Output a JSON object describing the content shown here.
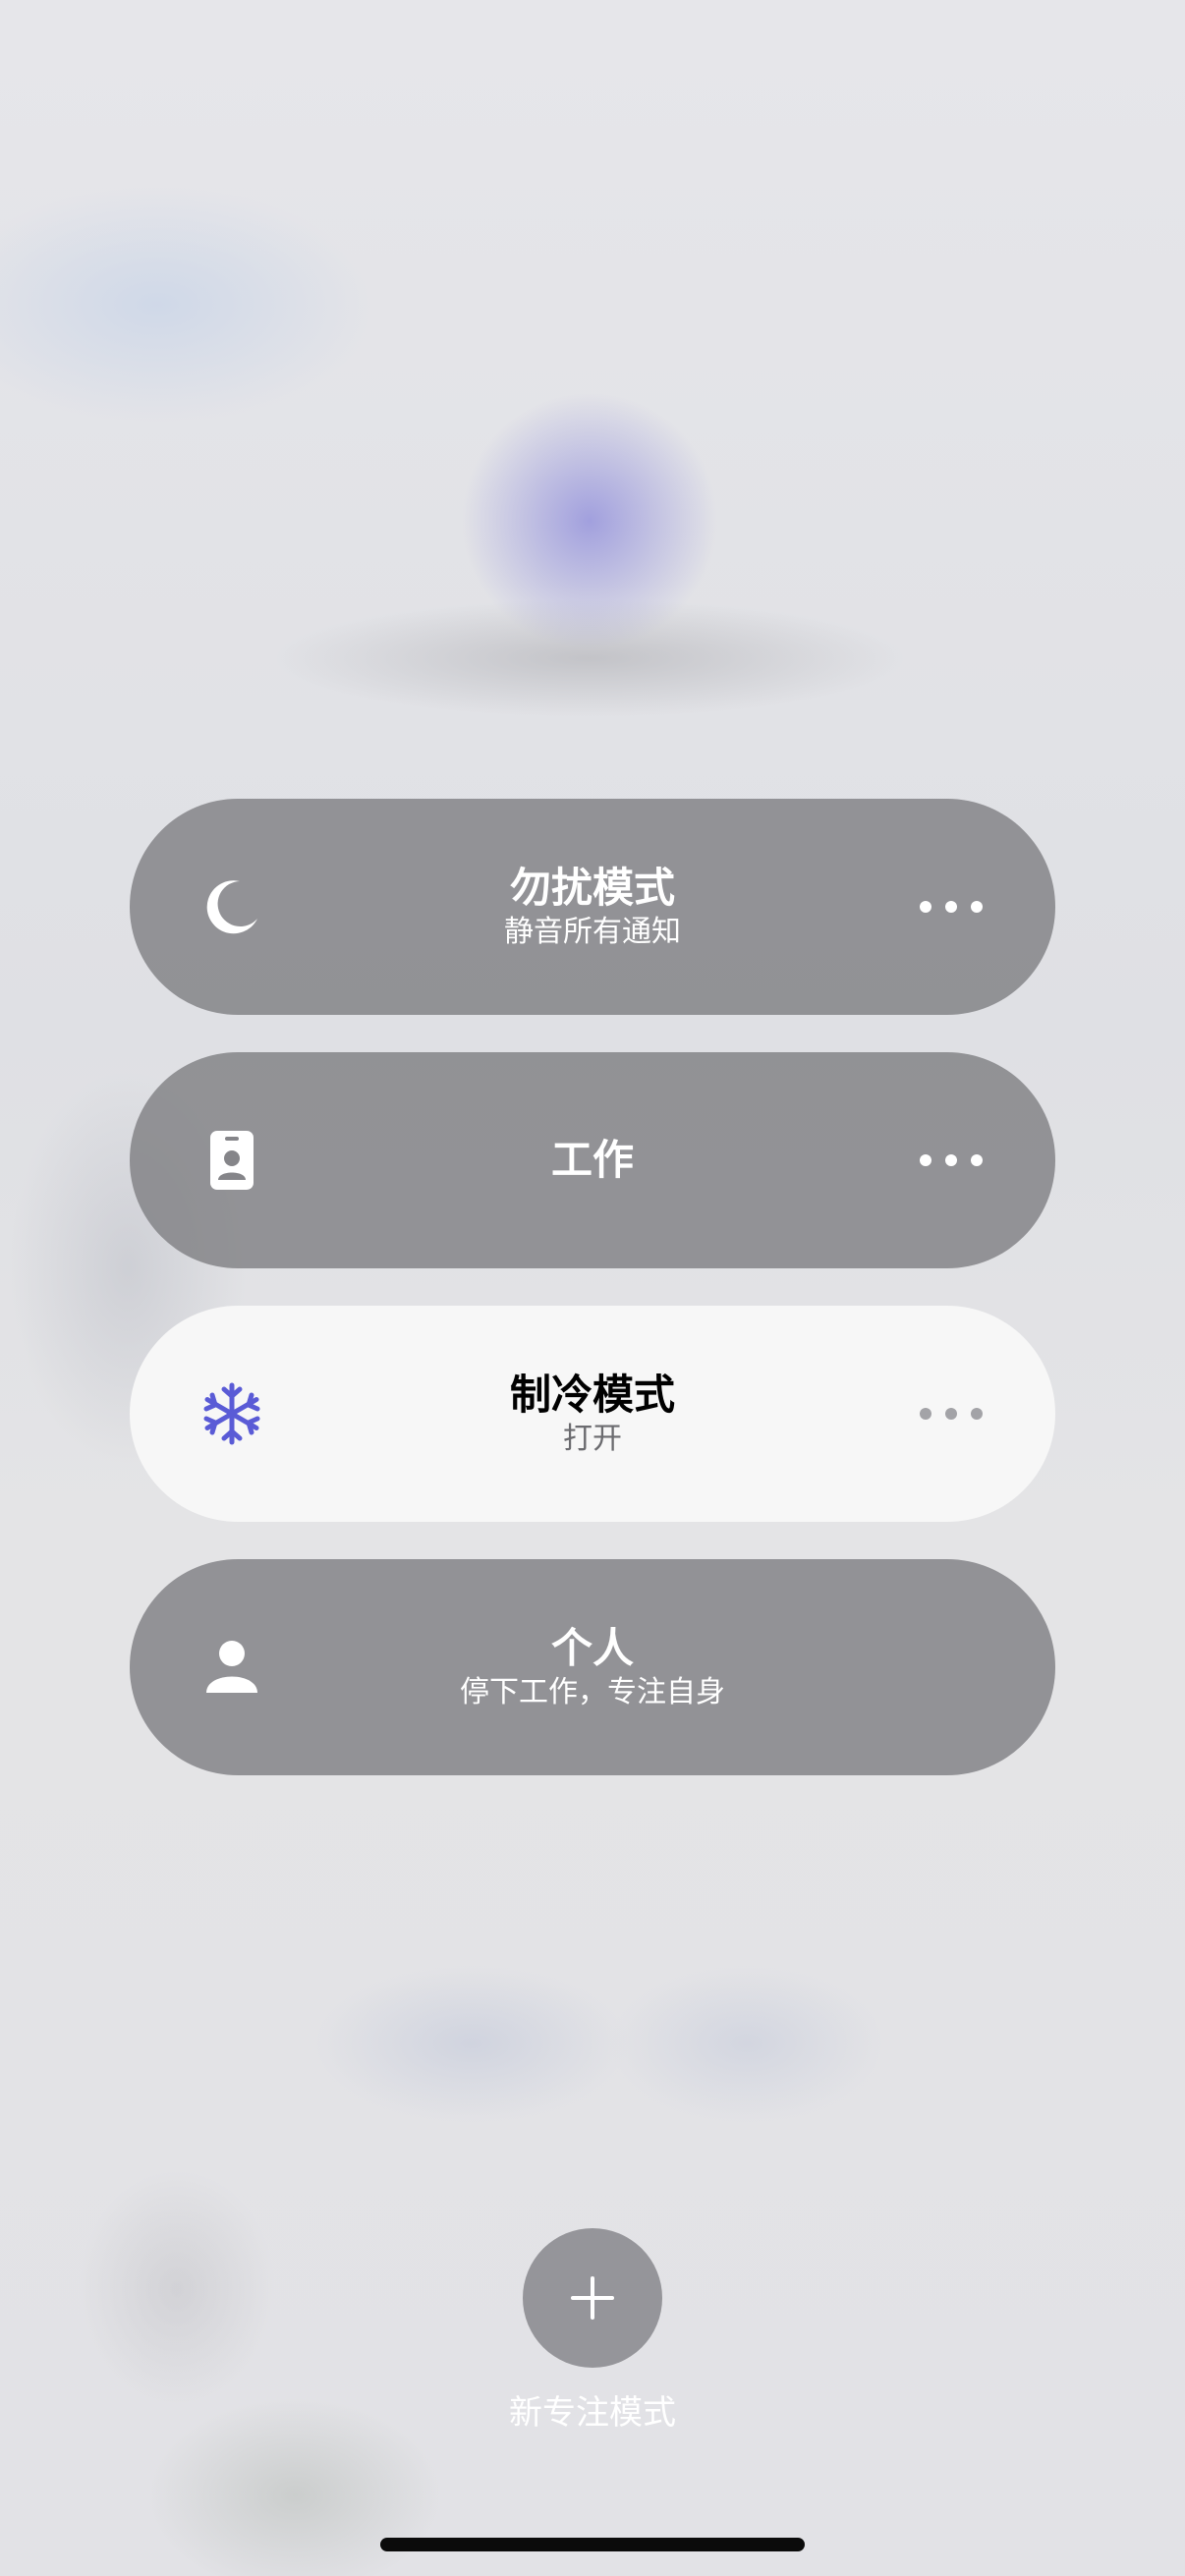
{
  "focus_modes": [
    {
      "icon": "moon-icon",
      "title": "勿扰模式",
      "subtitle": "静音所有通知",
      "active": false,
      "has_more": true
    },
    {
      "icon": "id-badge-icon",
      "title": "工作",
      "subtitle": "",
      "active": false,
      "has_more": true
    },
    {
      "icon": "snowflake-icon",
      "title": "制冷模式",
      "subtitle": "打开",
      "active": true,
      "has_more": true,
      "icon_color": "#5a5bd6"
    },
    {
      "icon": "person-icon",
      "title": "个人",
      "subtitle": "停下工作，专注自身",
      "active": false,
      "has_more": false
    }
  ],
  "new_focus": {
    "icon": "plus-icon",
    "label": "新专注模式"
  },
  "colors": {
    "inactive_card": "#808084",
    "active_card": "#f7f7f7",
    "accent": "#5a5bd6"
  }
}
